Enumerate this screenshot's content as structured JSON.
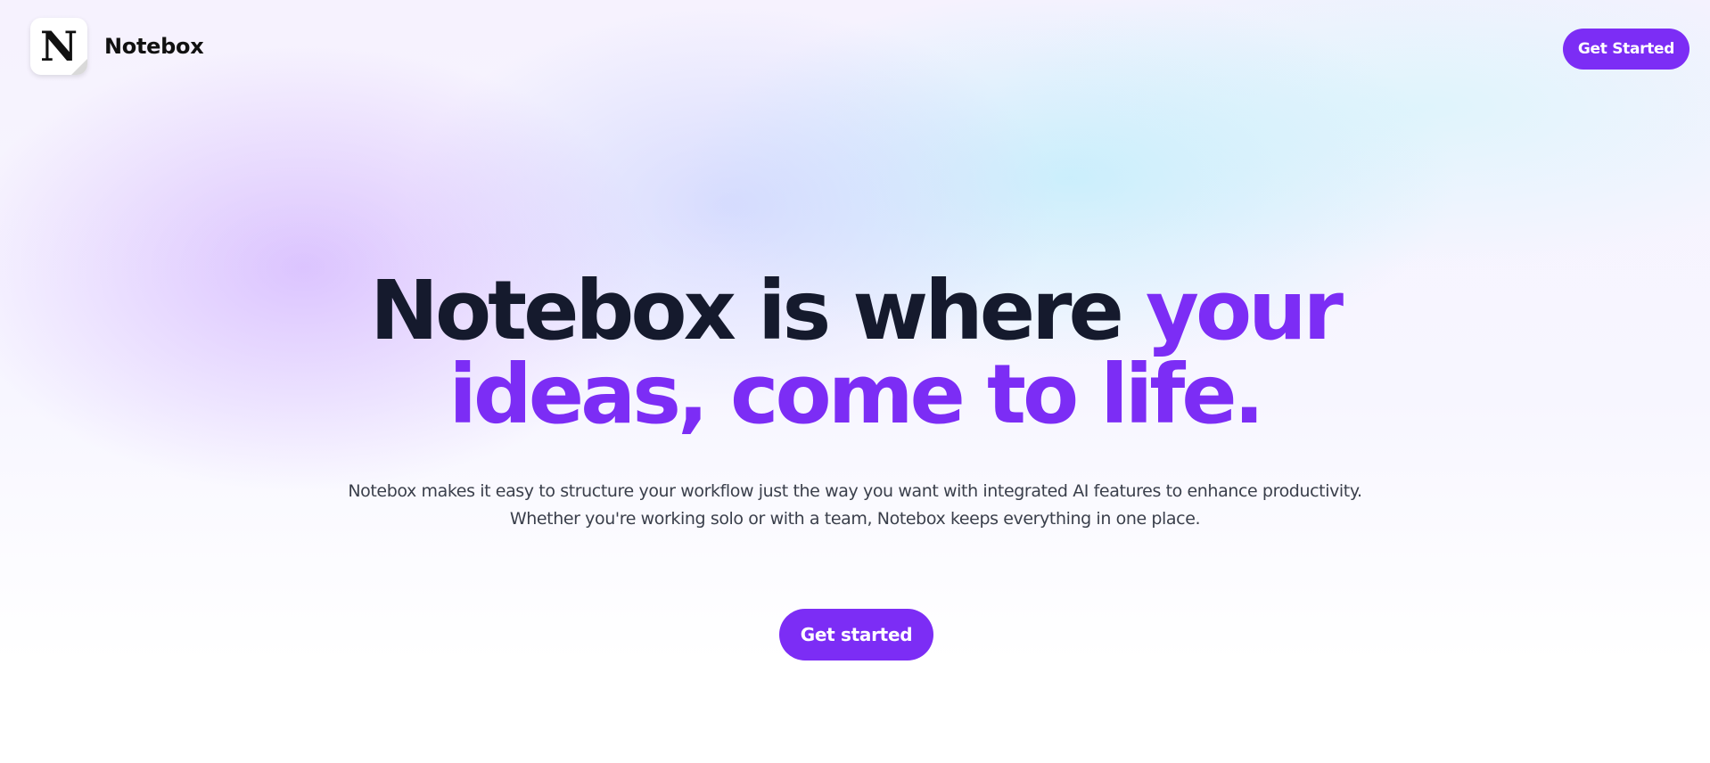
{
  "header": {
    "logo_letter": "N",
    "brand_name": "Notebox",
    "cta_label": "Get Started"
  },
  "hero": {
    "headline_part1": "Notebox is where ",
    "headline_part2": "your",
    "headline_line2": "ideas, come to life.",
    "subtitle_line1": "Notebox makes it easy to structure your workflow just the way you want with integrated AI features to enhance productivity.",
    "subtitle_line2": "Whether you're working solo or with a team, Notebox keeps everything in one place.",
    "cta_label": "Get started"
  },
  "colors": {
    "accent": "#7c2df5",
    "headline": "#151a2d",
    "body_text": "#3a3f4b"
  }
}
